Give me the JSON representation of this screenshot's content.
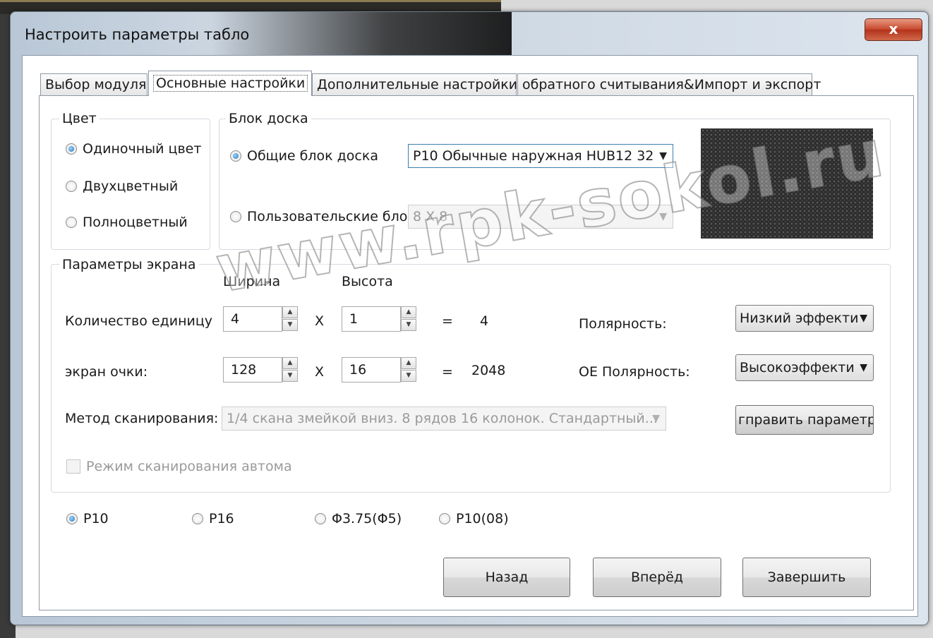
{
  "window": {
    "title": "Настроить параметры табло",
    "close_label": "x"
  },
  "tabs": [
    {
      "label": "Выбор модуля",
      "active": false
    },
    {
      "label": "Основные настройки",
      "active": true
    },
    {
      "label": "Дополнительные настройки",
      "active": false
    },
    {
      "label": "обратного считывания&Импорт и экспорт",
      "active": false
    }
  ],
  "color_group": {
    "label": "Цвет",
    "options": [
      {
        "label": "Одиночный цвет",
        "checked": true
      },
      {
        "label": "Двухцветный",
        "checked": false
      },
      {
        "label": "Полноцветный",
        "checked": false
      }
    ]
  },
  "board_group": {
    "label": "Блок доска",
    "general_label": "Общие блок доска",
    "general_checked": true,
    "general_value": "P10  Обычные наружная  HUB12 32",
    "custom_label": "Пользовательские бло",
    "custom_checked": false,
    "custom_value": "8 X 8",
    "image_icon": "led-module-image"
  },
  "screen_group": {
    "label": "Параметры экрана",
    "width_header": "Ширина",
    "height_header": "Высота",
    "units_label": "Количество единицу",
    "units_width": "4",
    "units_x": "X",
    "units_height": "1",
    "units_eq": "=",
    "units_total": "4",
    "pixels_label": "экран очки:",
    "pixels_width": "128",
    "pixels_x": "X",
    "pixels_height": "16",
    "pixels_eq": "=",
    "pixels_total": "2048",
    "polarity_label": "Полярность:",
    "polarity_value": "Низкий эффекти",
    "oe_polarity_label": "OE Полярность:",
    "oe_polarity_value": "Высокоэффекти",
    "scan_label": "Метод сканирования:",
    "scan_value": "1/4 скана змейкой вниз. 8 рядов 16 колонок. Стандартный...",
    "fix_button": "гправить параметрі",
    "auto_scan_label": "Режим сканирования автома",
    "auto_scan_checked": false
  },
  "pitch_options": [
    {
      "label": "P10",
      "checked": true
    },
    {
      "label": "P16",
      "checked": false
    },
    {
      "label": "Φ3.75(Φ5)",
      "checked": false
    },
    {
      "label": "P10(08)",
      "checked": false
    }
  ],
  "footer": {
    "back": "Назад",
    "next": "Вперёд",
    "finish": "Завершить"
  },
  "watermark": "www.rpk-sokol.ru"
}
